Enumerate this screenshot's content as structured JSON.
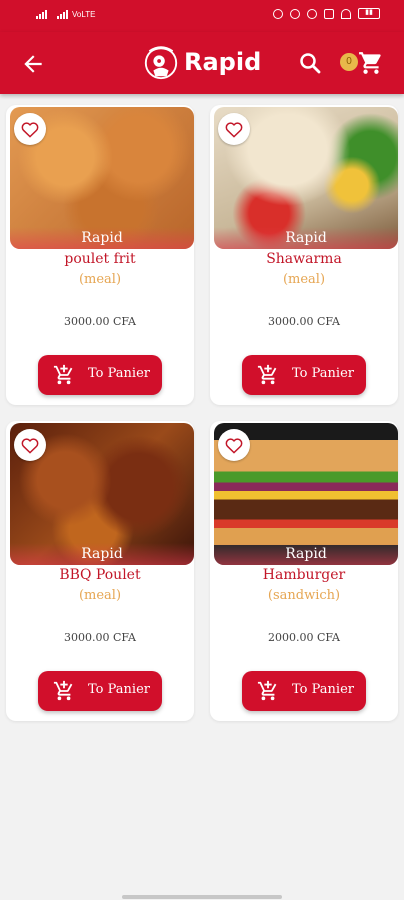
{
  "status": {
    "left": "VoLTE"
  },
  "app": {
    "name": "Rapid",
    "cart_count": "0",
    "colors": {
      "primary": "#d10f2b",
      "category": "#e6a653",
      "name": "#c21628"
    }
  },
  "products": [
    {
      "brand": "Rapid",
      "name": "poulet frit",
      "category": "(meal)",
      "price": "3000.00 CFA",
      "button": "To Panier"
    },
    {
      "brand": "Rapid",
      "name": "Shawarma",
      "category": "(meal)",
      "price": "3000.00 CFA",
      "button": "To Panier"
    },
    {
      "brand": "Rapid",
      "name": "BBQ Poulet",
      "category": "(meal)",
      "price": "3000.00 CFA",
      "button": "To Panier"
    },
    {
      "brand": "Rapid",
      "name": "Hamburger",
      "category": "(sandwich)",
      "price": "2000.00 CFA",
      "button": "To Panier"
    }
  ]
}
